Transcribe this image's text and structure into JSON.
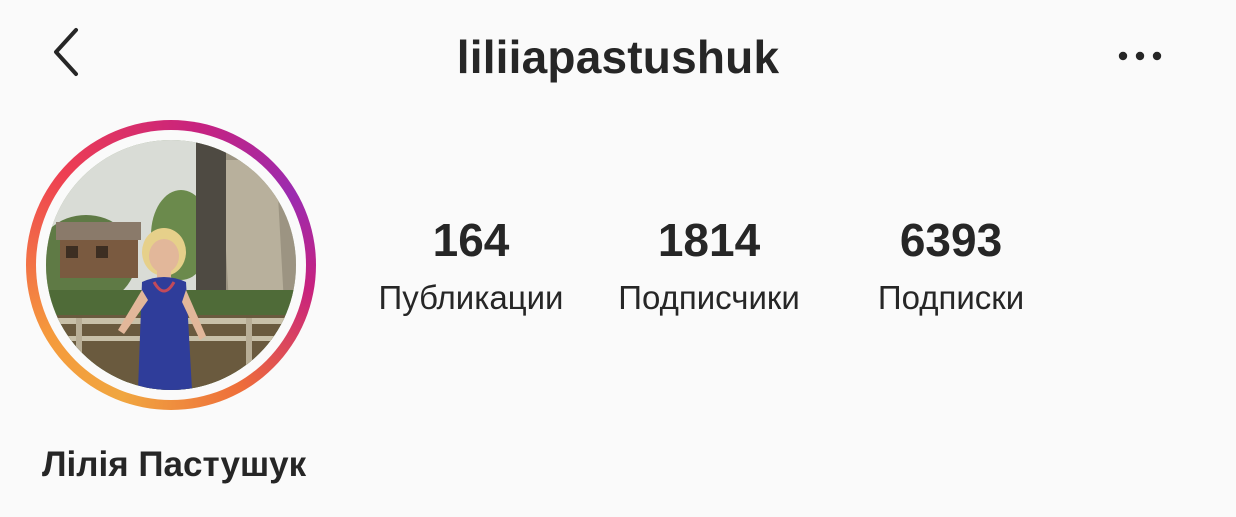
{
  "header": {
    "username": "liliiapastushuk",
    "back_icon": "chevron-left-icon",
    "more_icon": "more-horizontal-icon"
  },
  "profile": {
    "avatar_alt": "profile photo",
    "full_name": "Лілія Пастушук",
    "stats": [
      {
        "value": "164",
        "label": "Публикации"
      },
      {
        "value": "1814",
        "label": "Подписчики"
      },
      {
        "value": "6393",
        "label": "Подписки"
      }
    ]
  },
  "colors": {
    "background": "#fafafa",
    "text": "#262626",
    "story_ring_start": "#f0a640",
    "story_ring_mid": "#ee3f52",
    "story_ring_end": "#9b2bb0"
  }
}
